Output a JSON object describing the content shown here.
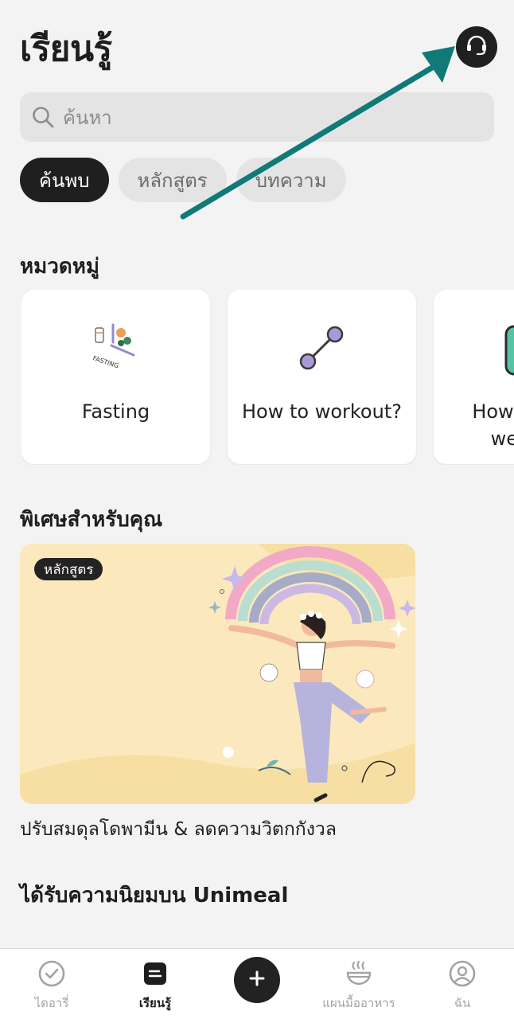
{
  "header": {
    "title": "เรียนรู้",
    "support_icon": "headset-icon"
  },
  "search": {
    "placeholder": "ค้นหา",
    "icon": "search-icon"
  },
  "tabs": [
    {
      "label": "ค้นพบ",
      "active": true
    },
    {
      "label": "หลักสูตร",
      "active": false
    },
    {
      "label": "บทความ",
      "active": false
    }
  ],
  "categories": {
    "title": "หมวดหมู่",
    "items": [
      {
        "label": "Fasting",
        "icon": "fasting-illustration-icon",
        "icon_text": "FASTING"
      },
      {
        "label": "How to workout?",
        "icon": "dumbbell-icon"
      },
      {
        "label": "How to lose weight?",
        "icon": "scale-icon"
      }
    ]
  },
  "featured": {
    "title": "พิเศษสำหรับคุณ",
    "badge": "หลักสูตร",
    "card_title": "ปรับสมดุลโดพามีน & ลดความวิตกกังวล"
  },
  "popular": {
    "title": "ได้รับความนิยมบน Unimeal"
  },
  "nav": {
    "items": [
      {
        "label": "ไดอารี่",
        "icon": "check-circle-icon",
        "active": false
      },
      {
        "label": "เรียนรู้",
        "icon": "learn-card-icon",
        "active": true
      },
      {
        "label": "",
        "icon": "plus-icon",
        "active": false
      },
      {
        "label": "แผนมื้ออาหาร",
        "icon": "food-bowl-icon",
        "active": false
      },
      {
        "label": "ฉัน",
        "icon": "profile-icon",
        "active": false
      }
    ]
  },
  "colors": {
    "accent_dark": "#1f1f1f",
    "background": "#f3f3f3",
    "promo_bg": "#fbe9bd",
    "annotation_arrow": "#0f7a78",
    "dumbbell": "#a79ad6"
  }
}
